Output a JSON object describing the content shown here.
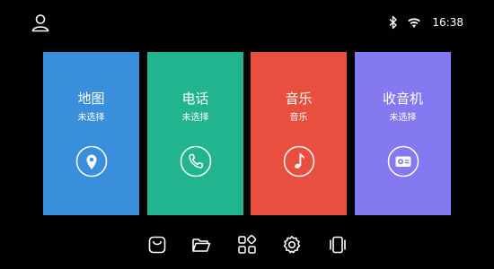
{
  "status_bar": {
    "time": "16:38",
    "icons": [
      "user-icon",
      "bluetooth-icon",
      "wifi-icon"
    ]
  },
  "tiles": [
    {
      "title": "地图",
      "subtitle": "未选择",
      "icon": "map-pin-icon",
      "color": "#3a8fdc"
    },
    {
      "title": "电话",
      "subtitle": "未选择",
      "icon": "phone-icon",
      "color": "#22b48e"
    },
    {
      "title": "音乐",
      "subtitle": "音乐",
      "icon": "music-note-icon",
      "color": "#e84f3f"
    },
    {
      "title": "收音机",
      "subtitle": "未选择",
      "icon": "radio-icon",
      "color": "#8479f1"
    }
  ],
  "dock": {
    "icons": [
      "bag-icon",
      "folder-icon",
      "apps-grid-icon",
      "settings-icon",
      "multitask-icon"
    ]
  }
}
